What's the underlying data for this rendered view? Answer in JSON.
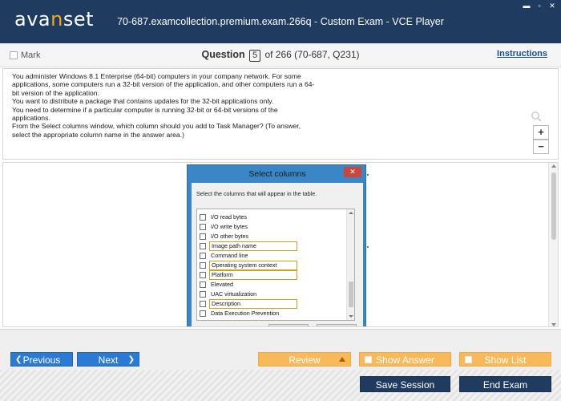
{
  "window": {
    "logo": "avanset",
    "title": "70-687.examcollection.premium.exam.266q - Custom Exam - VCE Player"
  },
  "toolbar": {
    "mark_label": "Mark",
    "question_label": "Question",
    "question_number": "5",
    "question_total": "of 266 (70-687, Q231)",
    "instructions_label": "Instructions"
  },
  "question": {
    "lines": [
      "You administer Windows 8.1 Enterprise (64-bit) computers in your company network. For some applications, some computers run a 32-bit version of the application, and other computers run a 64-bit version of the application.",
      "You want to distribute a package that contains updates for the 32-bit applications only.",
      "You need to determine if a particular computer is running 32-bit or 64-bit versions of the applications.",
      "From the Select columns window, which column should you add to Task Manager? (To answer, select the appropriate column name in the answer area.)"
    ],
    "zoom_in": "+",
    "zoom_out": "−"
  },
  "exhibit": {
    "dialog_title": "Select columns",
    "close_glyph": "✕",
    "prompt": "Select the columns that will appear in the table.",
    "items": [
      {
        "label": "I/O read bytes",
        "highlighted": false
      },
      {
        "label": "I/O write bytes",
        "highlighted": false
      },
      {
        "label": "I/O other bytes",
        "highlighted": false
      },
      {
        "label": "Image path name",
        "highlighted": true
      },
      {
        "label": "Command line",
        "highlighted": false
      },
      {
        "label": "Operating system context",
        "highlighted": true
      },
      {
        "label": "Platform",
        "highlighted": true
      },
      {
        "label": "Elevated",
        "highlighted": false
      },
      {
        "label": "UAC virtualization",
        "highlighted": false
      },
      {
        "label": "Description",
        "highlighted": true
      },
      {
        "label": "Data Execution Prevention",
        "highlighted": false
      }
    ]
  },
  "nav": {
    "previous": "Previous",
    "next": "Next",
    "review": "Review",
    "show_answer": "Show Answer",
    "show_list": "Show List",
    "save_session": "Save Session",
    "end_exam": "End Exam"
  },
  "colors": {
    "titlebar": "#1f3b5f",
    "nav_blue": "#2b7bd4",
    "orange": "#f8b95a",
    "highlight_border": "#c9a227"
  }
}
